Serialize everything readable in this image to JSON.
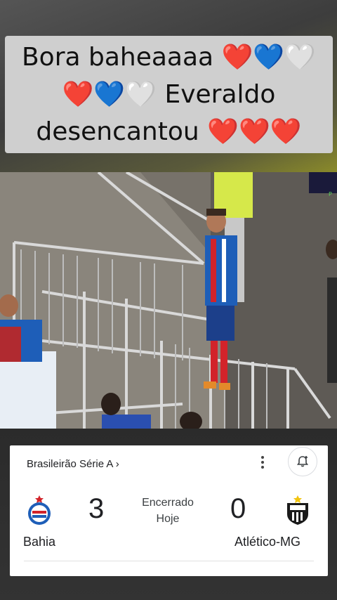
{
  "caption": {
    "line1": "Bora baheaaaa ❤️💙🤍",
    "line2": "❤️💙🤍 Everaldo",
    "line3": "desencantou ❤️❤️❤️"
  },
  "match": {
    "competition": "Brasileirão Série A ›",
    "home_team": "Bahia",
    "home_score": "3",
    "away_team": "Atlético-MG",
    "away_score": "0",
    "status": "Encerrado",
    "date": "Hoje",
    "home_logo_text": "E.C.BAHIA",
    "away_logo_text": "CAM"
  },
  "icons": {
    "more": "more-vert-icon",
    "notify": "bell-add-icon"
  },
  "colors": {
    "bahia_blue": "#1e5eb8",
    "bahia_red": "#d2232a",
    "card_bg": "#ffffff",
    "caption_bg": "#cfcfcf"
  }
}
